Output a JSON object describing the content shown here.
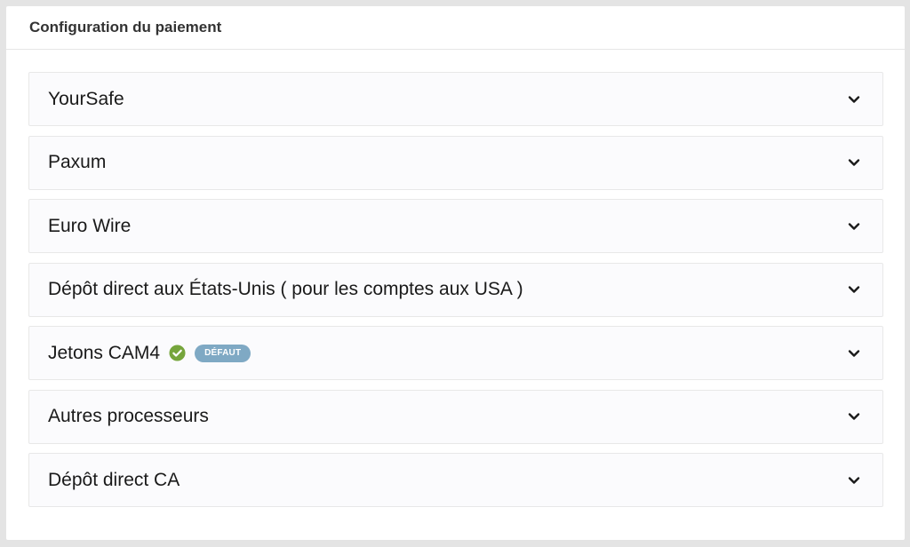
{
  "panel": {
    "title": "Configuration du paiement"
  },
  "methods": [
    {
      "label": "YourSafe"
    },
    {
      "label": "Paxum"
    },
    {
      "label": "Euro Wire"
    },
    {
      "label": "Dépôt direct aux États-Unis ( pour les comptes aux USA )"
    },
    {
      "label": "Jetons CAM4",
      "default_badge": "DÉFAUT",
      "verified_icon": "check-circle-icon"
    },
    {
      "label": "Autres processeurs"
    },
    {
      "label": "Dépôt direct CA"
    }
  ],
  "colors": {
    "badge": "#7fa9c4",
    "check": "#76a53c"
  },
  "icons": {
    "expand": "chevron-down-icon"
  }
}
